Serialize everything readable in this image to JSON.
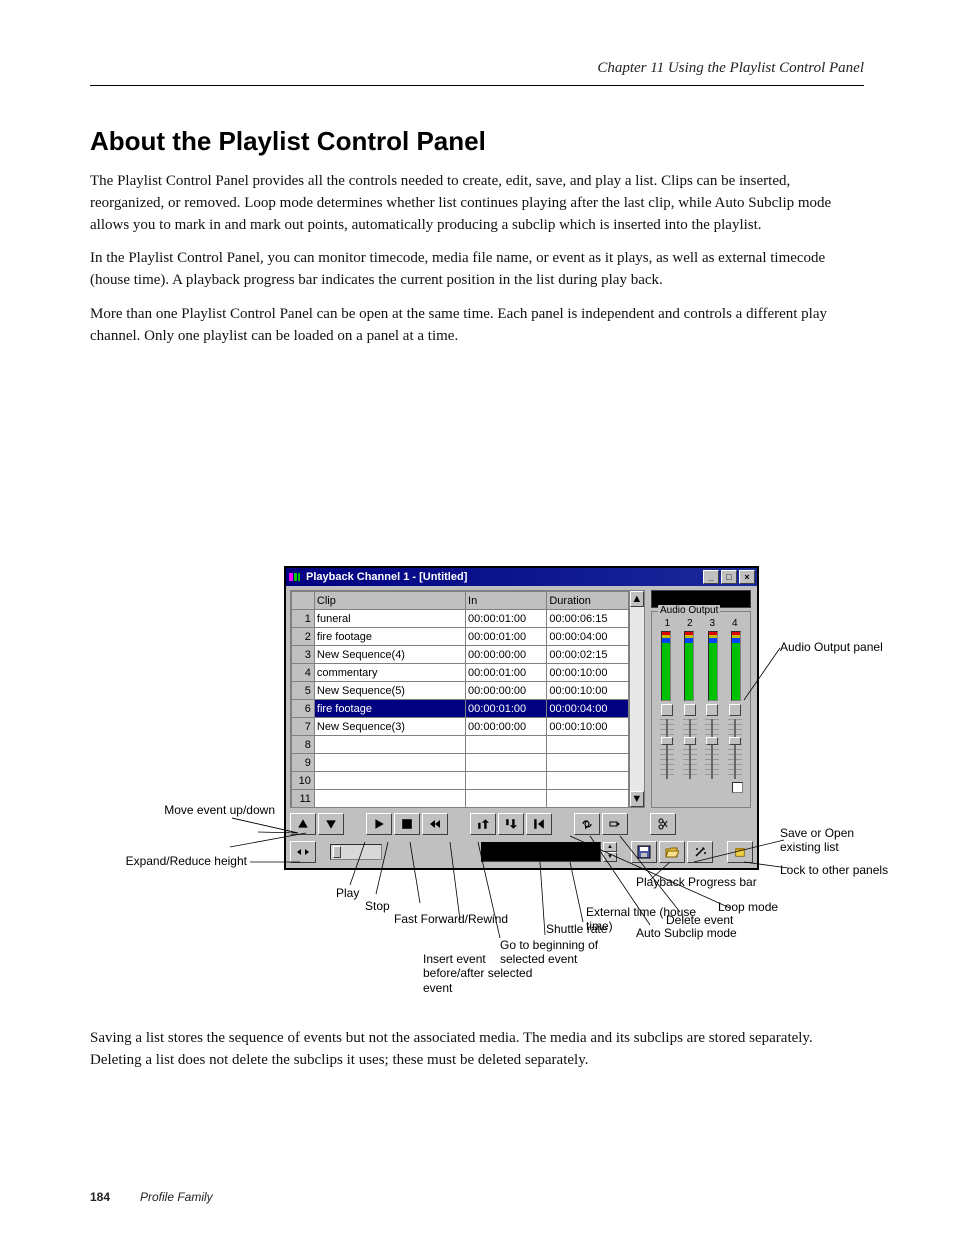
{
  "header": {
    "running": "Chapter 11   Using the Playlist Control Panel"
  },
  "title": "About the Playlist Control Panel",
  "paras": {
    "p1": "The Playlist Control Panel provides all the controls needed to create, edit, save, and play a list. Clips can be inserted, reorganized, or removed. Loop mode determines whether list continues playing after the last clip, while Auto Subclip mode allows you to mark in and mark out points, automatically producing a subclip which is inserted into the playlist.",
    "p2": "In the Playlist Control Panel, you can monitor timecode, media file name, or event as it plays, as well as external timecode (house time). A playback progress bar indicates the current position in the list during play back.",
    "p3": "More than one Playlist Control Panel can be open at the same time. Each panel is independent and controls a different play channel. Only one playlist can be loaded on a panel at a time.",
    "p4": "Saving a list stores the sequence of events but not the associated media. The media and its subclips are stored separately. Deleting a list does not delete the subclips it uses; these must be deleted separately."
  },
  "window": {
    "title": "Playback Channel 1 - [Untitled]",
    "columns": {
      "idx": "",
      "clip": "Clip",
      "in": "In",
      "dur": "Duration"
    },
    "rows": [
      {
        "n": "1",
        "clip": "funeral",
        "in": "00:00:01:00",
        "dur": "00:00:06:15",
        "sel": false
      },
      {
        "n": "2",
        "clip": "fire footage",
        "in": "00:00:01:00",
        "dur": "00:00:04:00",
        "sel": false
      },
      {
        "n": "3",
        "clip": "New Sequence(4)",
        "in": "00:00:00:00",
        "dur": "00:00:02:15",
        "sel": false
      },
      {
        "n": "4",
        "clip": "commentary",
        "in": "00:00:01:00",
        "dur": "00:00:10:00",
        "sel": false
      },
      {
        "n": "5",
        "clip": "New Sequence(5)",
        "in": "00:00:00:00",
        "dur": "00:00:10:00",
        "sel": false
      },
      {
        "n": "6",
        "clip": "fire footage",
        "in": "00:00:01:00",
        "dur": "00:00:04:00",
        "sel": true
      },
      {
        "n": "7",
        "clip": "New Sequence(3)",
        "in": "00:00:00:00",
        "dur": "00:00:10:00",
        "sel": false
      },
      {
        "n": "8",
        "clip": "",
        "in": "",
        "dur": "",
        "sel": false
      },
      {
        "n": "9",
        "clip": "",
        "in": "",
        "dur": "",
        "sel": false
      },
      {
        "n": "10",
        "clip": "",
        "in": "",
        "dur": "",
        "sel": false
      },
      {
        "n": "11",
        "clip": "",
        "in": "",
        "dur": "",
        "sel": false
      }
    ],
    "audio": {
      "legend": "Audio Output",
      "channels": [
        "1",
        "2",
        "3",
        "4"
      ]
    }
  },
  "labels": {
    "la": "Move event  up/down",
    "lb": "Expand/Reduce height",
    "lc": "Play",
    "ld": "Stop",
    "le": "Fast Forward/Rewind",
    "lf": "Insert event before/after selected event",
    "lg": "Go to beginning of selected event",
    "lh": "Shuttle rate",
    "li": "External time (house time)",
    "r1": "Audio Output panel",
    "r2": "Save or Open existing list",
    "r3": "Lock to other panels",
    "r4": "Loop mode",
    "r5": "Delete event",
    "r6": "Auto Subclip mode",
    "r7": "Playback Progress bar"
  },
  "footer": {
    "page": "184",
    "text": "Profile Family"
  }
}
